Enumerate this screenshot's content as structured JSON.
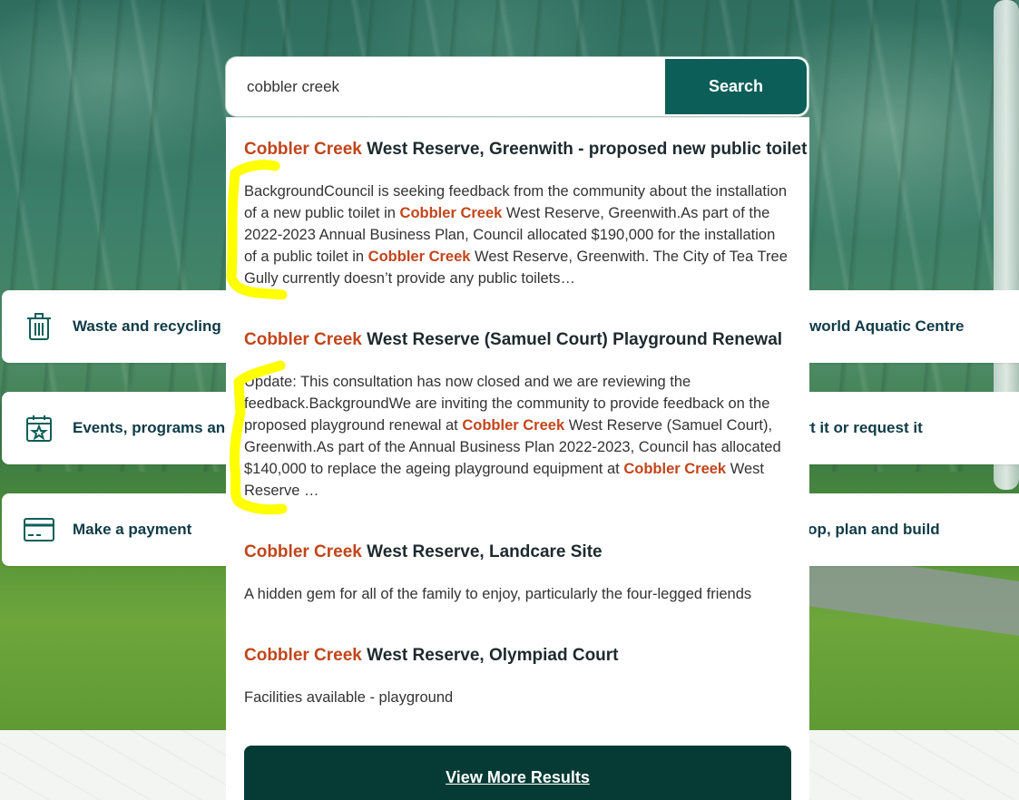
{
  "search": {
    "value": "cobbler creek",
    "button_label": "Search"
  },
  "quick_links": {
    "left": [
      {
        "label": "Waste and recycling",
        "icon": "bin-icon"
      },
      {
        "label": "Events, programs and",
        "icon": "calendar-star-icon"
      },
      {
        "label": "Make a payment",
        "icon": "credit-card-icon"
      }
    ],
    "right": [
      {
        "label": "erworld Aquatic Centre"
      },
      {
        "label": "ort it or request it"
      },
      {
        "label": "elop, plan and build"
      }
    ]
  },
  "results": [
    {
      "title_highlight": "Cobbler Creek",
      "title_rest": " West Reserve, Greenwith - proposed new public toilet",
      "text_parts": [
        "BackgroundCouncil is seeking feedback from the community about the installation of a new public toilet in ",
        "Cobbler Creek",
        " West Reserve, Greenwith.As part of the 2022-2023 Annual Business Plan, Council allocated $190,000 for the installation of a public toilet in ",
        "Cobbler Creek",
        " West Reserve, Greenwith. The City of Tea Tree Gully currently doesn’t provide any public toilets…"
      ]
    },
    {
      "title_highlight": "Cobbler Creek",
      "title_rest": " West Reserve (Samuel Court) Playground Renewal",
      "text_parts": [
        "Update: This consultation has now closed and we are reviewing the feedback.BackgroundWe are inviting the community to provide feedback on the proposed playground renewal at ",
        "Cobbler Creek",
        " West Reserve (Samuel Court), Greenwith.As part of the Annual Business Plan 2022-2023, Council has allocated $140,000 to replace the ageing playground equipment at ",
        "Cobbler Creek",
        " West Reserve …"
      ]
    },
    {
      "title_highlight": "Cobbler Creek",
      "title_rest": " West Reserve, Landcare Site",
      "text_parts": [
        "A hidden gem for all of the family to enjoy, particularly the four-legged friends"
      ]
    },
    {
      "title_highlight": "Cobbler Creek",
      "title_rest": " West Reserve, Olympiad Court",
      "text_parts": [
        "Facilities available - playground"
      ]
    }
  ],
  "view_more_label": "View More Results",
  "colors": {
    "accent": "#0c5f58",
    "highlight": "#c2451b",
    "view_more_bg": "#063b35",
    "annotation": "#ffff00"
  }
}
